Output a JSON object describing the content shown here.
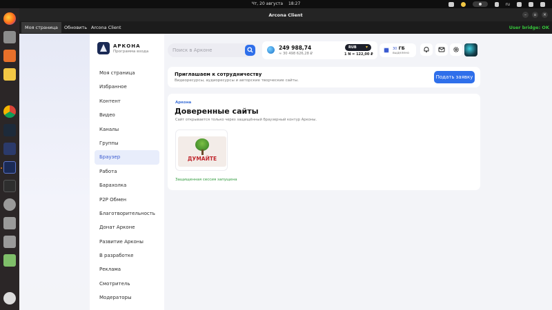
{
  "system_bar": {
    "date": "Чт, 20 августа",
    "time": "18:27",
    "lang": "ru"
  },
  "window": {
    "title": "Arcona Client",
    "minimize": "–",
    "restore": "▫",
    "close": "×"
  },
  "menubar": {
    "items": [
      "Моя страница",
      "Обновить",
      "Arcona Client"
    ],
    "bridge_status": "User bridge: OK"
  },
  "brand": {
    "name": "АРКОНА",
    "subtitle": "Программа входа"
  },
  "nav": {
    "items": [
      "Моя страница",
      "Избранное",
      "Контент",
      "Видео",
      "Каналы",
      "Группы",
      "Браузер",
      "Работа",
      "Барахолка",
      "P2P Обмен",
      "Благотворительность",
      "Донат Арконе",
      "Развитие Арконы",
      "В разработке",
      "Реклама",
      "Смотритель",
      "Модераторы"
    ],
    "active_index": 6
  },
  "search": {
    "placeholder": "Поиск в Арконе",
    "value": ""
  },
  "balance": {
    "amount": "249 988,74",
    "fiat": "≈ 30 498 626,28 ₽",
    "currency": "RUB",
    "rate": "1 N = 122,00 ₽"
  },
  "storage": {
    "value": "ГБ",
    "value_prefix": "30",
    "label": "выделено"
  },
  "invite": {
    "title": "Приглашаем к сотрудничеству",
    "description": "Видеоресурсы, аудиоресурсы и авторские творческие сайты.",
    "button": "Подать заявку"
  },
  "sites": {
    "kicker": "Аркона",
    "title": "Доверенные сайты",
    "description": "Сайт открывается только через защищённый браузерный контур Арконы.",
    "tile_label": "ДУМАЙТЕ",
    "status": "Защищенная сессия запущена"
  },
  "colors": {
    "accent": "#2f6fea",
    "active_nav_bg": "#e8edfb",
    "active_nav_text": "#3b5bd0",
    "bridge_ok": "#35c43b",
    "status_ok": "#2e9a3b",
    "tile_text": "#c0272d"
  },
  "dock_icons": [
    "firefox-icon",
    "files-icon",
    "app-store-icon",
    "text-editor-icon",
    "chrome-icon",
    "app-icon",
    "arcona-a-icon",
    "arcona-client-icon",
    "terminal-icon",
    "disk-icon",
    "drive-icon",
    "drive2-icon",
    "trash-icon",
    "apps-grid-icon"
  ]
}
